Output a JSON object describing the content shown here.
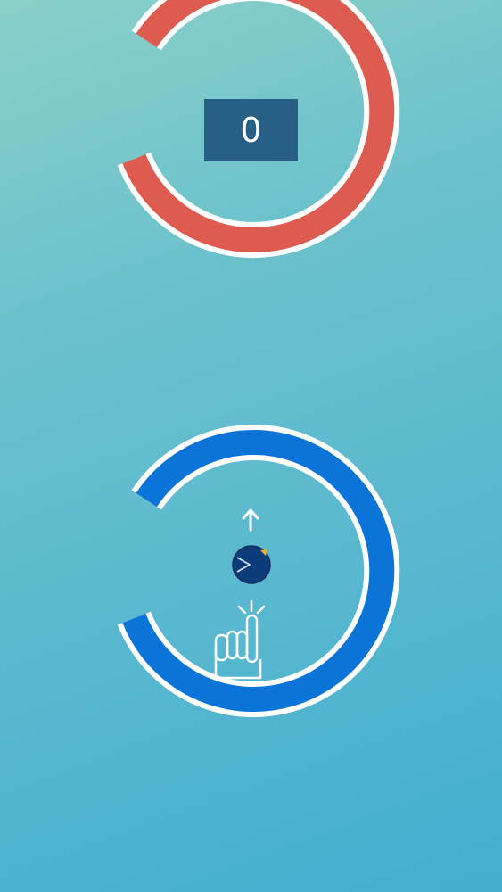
{
  "score": {
    "value": "0"
  },
  "colors": {
    "top_ring": "#dd5b4f",
    "bottom_ring": "#0a74d8",
    "ring_outline": "#ffffff",
    "score_box": "#285f86",
    "player_ball": "#0d3c7a",
    "player_beak": "#f4b223",
    "hint_strokes": "#ffffff"
  },
  "icons": {
    "arrow": "arrow-up-icon",
    "hand": "tap-hand-icon",
    "player": "player-ball-icon"
  }
}
